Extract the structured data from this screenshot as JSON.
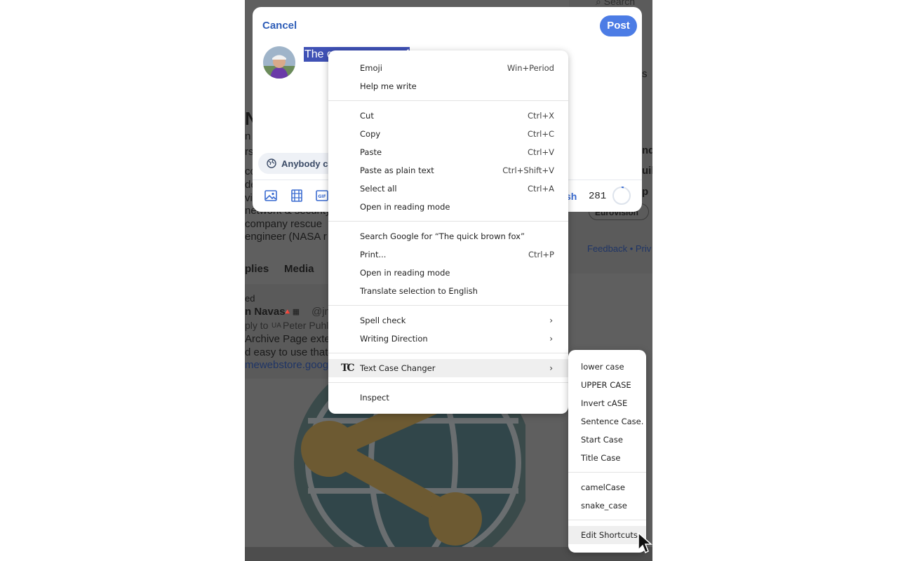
{
  "compose": {
    "cancel_label": "Cancel",
    "post_label": "Post",
    "draft_text": "The quick brown fox",
    "draft_visible": "The q",
    "draft_visible_end": "f",
    "audience_label": "Anybody ca",
    "language_label": "sh",
    "char_count": "281"
  },
  "background": {
    "search": "Search",
    "lines": [
      "n",
      "n",
      "rs",
      "co",
      "de",
      "vill",
      "network & security",
      "company rescue",
      "engineer (NASA r"
    ],
    "tabs": [
      "plies",
      "Media"
    ],
    "feed_label": "ed",
    "feed_author": "n Navas",
    "feed_handle": "@jn",
    "feed_reply": "ply to",
    "feed_reply_to": "Peter Puhl",
    "feed_text1": "Archive Page exter",
    "feed_text2": "d easy to use that a",
    "feed_link": "mewebstore.goog",
    "right_col": [
      "s",
      "ndi",
      "uile",
      "p"
    ],
    "trend_pill": "Eurovision",
    "footer": "Feedback • Priv"
  },
  "context_menu": {
    "groups": [
      [
        {
          "label": "Emoji",
          "shortcut": "Win+Period"
        },
        {
          "label": "Help me write",
          "shortcut": ""
        }
      ],
      [
        {
          "label": "Cut",
          "shortcut": "Ctrl+X"
        },
        {
          "label": "Copy",
          "shortcut": "Ctrl+C"
        },
        {
          "label": "Paste",
          "shortcut": "Ctrl+V"
        },
        {
          "label": "Paste as plain text",
          "shortcut": "Ctrl+Shift+V"
        },
        {
          "label": "Select all",
          "shortcut": "Ctrl+A"
        },
        {
          "label": "Open in reading mode",
          "shortcut": ""
        }
      ],
      [
        {
          "label": "Search Google for “The quick brown fox”",
          "shortcut": ""
        },
        {
          "label": "Print...",
          "shortcut": "Ctrl+P"
        },
        {
          "label": "Open in reading mode",
          "shortcut": ""
        },
        {
          "label": "Translate selection to English",
          "shortcut": ""
        }
      ],
      [
        {
          "label": "Spell check",
          "submenu": true
        },
        {
          "label": "Writing Direction",
          "submenu": true
        }
      ],
      [
        {
          "label": "Text Case Changer",
          "submenu": true,
          "icon": "TC",
          "highlighted": true
        }
      ],
      [
        {
          "label": "Inspect",
          "shortcut": ""
        }
      ]
    ]
  },
  "submenu": {
    "groups": [
      [
        "lower case",
        "UPPER CASE",
        "Invert cASE",
        "Sentence Case.",
        "Start Case",
        "Title Case"
      ],
      [
        "camelCase",
        "snake_case"
      ],
      [
        "Edit Shortcuts"
      ]
    ],
    "highlighted": "Edit Shortcuts"
  },
  "colors": {
    "accent": "#4c7ce5",
    "selection": "#3f51b5",
    "overlay": "#5f5f5f"
  }
}
